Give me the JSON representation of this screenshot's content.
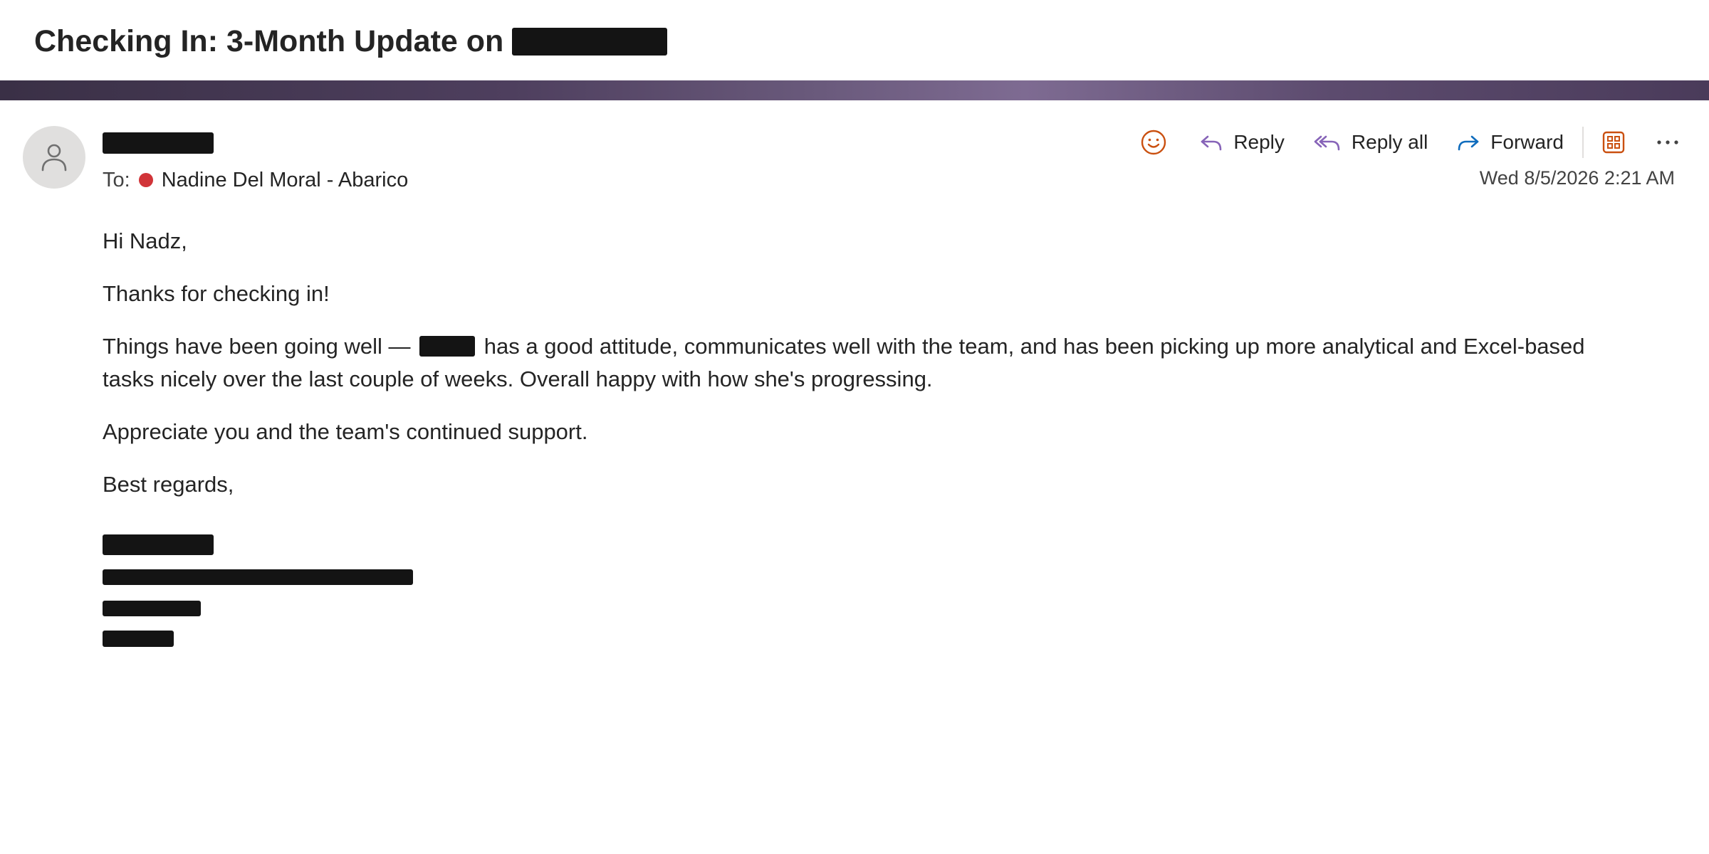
{
  "subject": {
    "title": "Checking In: 3-Month Update on"
  },
  "message": {
    "to_label": "To:",
    "recipient": "Nadine Del Moral - Abarico",
    "timestamp": "Wed 8/5/2026 2:21 AM"
  },
  "toolbar": {
    "emoji_icon": "smiley-icon",
    "reply_label": "Reply",
    "reply_all_label": "Reply all",
    "forward_label": "Forward",
    "apps_icon": "apps-icon",
    "more_icon": "more-icon"
  },
  "body": {
    "greeting": "Hi Nadz,",
    "p1": "Thanks for checking in!",
    "p2_start": "Things have been going well —",
    "p2_end": "has a good attitude, communicates well with the team, and has been picking up more analytical and Excel-based tasks nicely over the last couple of weeks. Overall happy with how she's progressing.",
    "p3": "Appreciate you and the team's continued support.",
    "closing": "Best regards,"
  },
  "colors": {
    "presence": "#d13438",
    "emoji": "#ca5010",
    "reply": "#8764b8",
    "forward": "#0f6cbd",
    "apps": "#ca5010"
  }
}
